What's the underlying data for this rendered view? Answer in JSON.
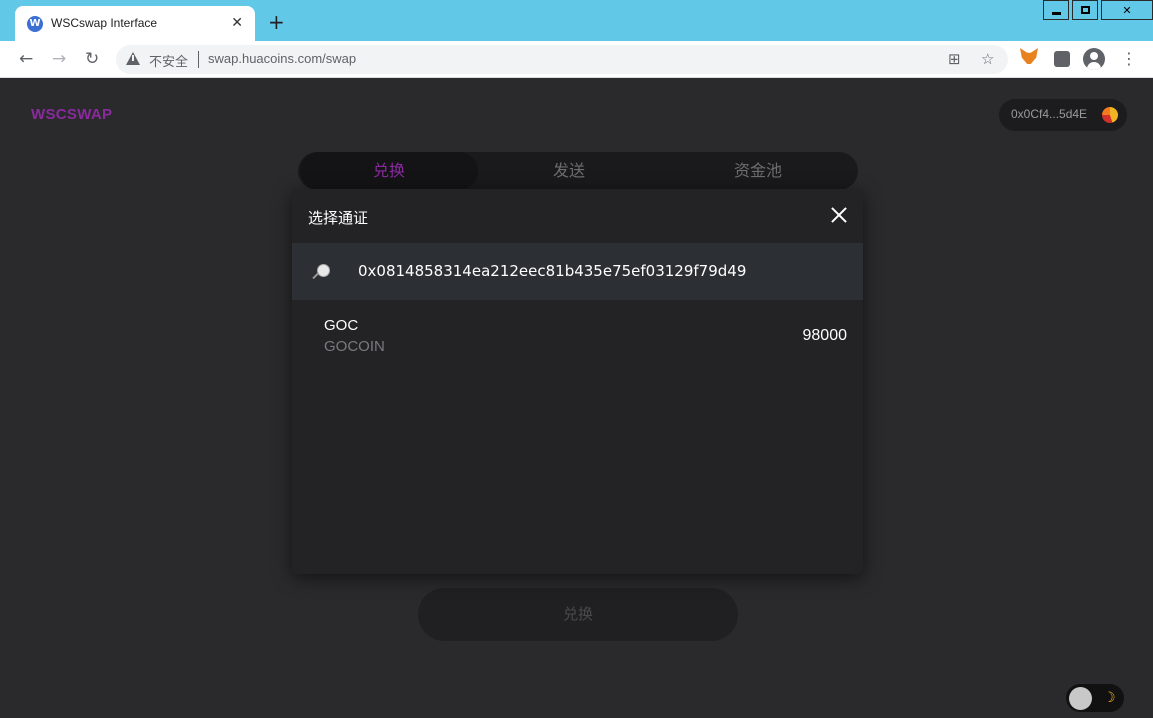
{
  "browser": {
    "tab_title": "WSCswap Interface",
    "tab_favicon_letter": "W",
    "tab_close": "✕",
    "new_tab": "+",
    "security_label": "不安全",
    "url": "swap.huacoins.com/swap",
    "nav_back": "←",
    "nav_forward": "→",
    "nav_reload": "↻",
    "menu": "⋮"
  },
  "app": {
    "logo": "WSCSWAP",
    "wallet_address": "0x0Cf4...5d4E",
    "tabs": [
      {
        "label": "兑换",
        "active": true
      },
      {
        "label": "发送",
        "active": false
      },
      {
        "label": "资金池",
        "active": false
      }
    ],
    "main_button_label": "兑换",
    "theme_icon": "☽"
  },
  "modal": {
    "title": "选择通证",
    "search_value": "0x0814858314ea212eec81b435e75ef03129f79d49",
    "tokens": [
      {
        "symbol": "GOC",
        "name": "GOCOIN",
        "balance": "98000"
      }
    ]
  },
  "colors": {
    "accent": "#8a2a9e",
    "background": "#2a2a2c",
    "modal": "#232326",
    "chrome_frame": "#62c8e8"
  }
}
